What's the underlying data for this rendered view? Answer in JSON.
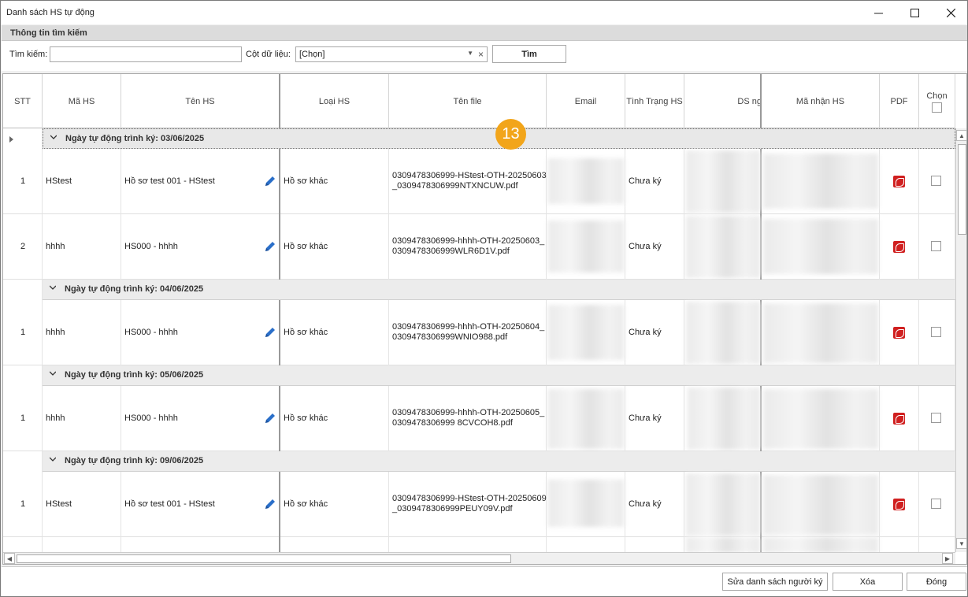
{
  "window": {
    "title": "Danh sách HS tự động"
  },
  "search_panel": {
    "header": "Thông tin tìm kiếm",
    "search_label": "Tìm kiếm:",
    "search_value": "",
    "column_label": "Cột dữ liệu:",
    "column_value": "[Chọn]",
    "find_button": "Tìm"
  },
  "columns": [
    "STT",
    "Mã HS",
    "Tên HS",
    "Loại HS",
    "Tên file",
    "Email",
    "Tình Trạng HS",
    "DS ng",
    "Mã nhận HS",
    "PDF",
    "Chọn"
  ],
  "groups": [
    {
      "label": "Ngày tự động trình ký: 03/06/2025",
      "rows": [
        {
          "stt": "1",
          "ma_hs": "HStest",
          "ten_hs": "Hồ sơ test 001 - HStest",
          "loai_hs": "Hồ sơ khác",
          "file_line1": "0309478306999-HStest-OTH-20250603",
          "file_line2": "_0309478306999NTXNCUW.pdf",
          "status": "Chưa ký"
        },
        {
          "stt": "2",
          "ma_hs": "hhhh",
          "ten_hs": "HS000 - hhhh",
          "loai_hs": "Hồ sơ khác",
          "file_line1": "0309478306999-hhhh-OTH-20250603_",
          "file_line2": "0309478306999WLR6D1V.pdf",
          "status": "Chưa ký"
        }
      ]
    },
    {
      "label": "Ngày tự động trình ký: 04/06/2025",
      "rows": [
        {
          "stt": "1",
          "ma_hs": "hhhh",
          "ten_hs": "HS000 - hhhh",
          "loai_hs": "Hồ sơ khác",
          "file_line1": "0309478306999-hhhh-OTH-20250604_",
          "file_line2": "0309478306999WNIO988.pdf",
          "status": "Chưa ký"
        }
      ]
    },
    {
      "label": "Ngày tự động trình ký: 05/06/2025",
      "rows": [
        {
          "stt": "1",
          "ma_hs": "hhhh",
          "ten_hs": "HS000 - hhhh",
          "loai_hs": "Hồ sơ khác",
          "file_line1": "0309478306999-hhhh-OTH-20250605_",
          "file_line2": "0309478306999 8CVCOH8.pdf",
          "status": "Chưa ký"
        }
      ]
    },
    {
      "label": "Ngày tự động trình ký: 09/06/2025",
      "rows": [
        {
          "stt": "1",
          "ma_hs": "HStest",
          "ten_hs": "Hồ sơ test 001 - HStest",
          "loai_hs": "Hồ sơ khác",
          "file_line1": "0309478306999-HStest-OTH-20250609",
          "file_line2": "_0309478306999PEUY09V.pdf",
          "status": "Chưa ký"
        }
      ]
    }
  ],
  "badge": "13",
  "footer": {
    "edit_signers": "Sửa danh sách người ký",
    "delete": "Xóa",
    "close": "Đóng"
  },
  "colors": {
    "badge": "#f2a51a",
    "pdf": "#d02020",
    "pencil": "#2a6fc9",
    "group_bg": "#ececec"
  }
}
